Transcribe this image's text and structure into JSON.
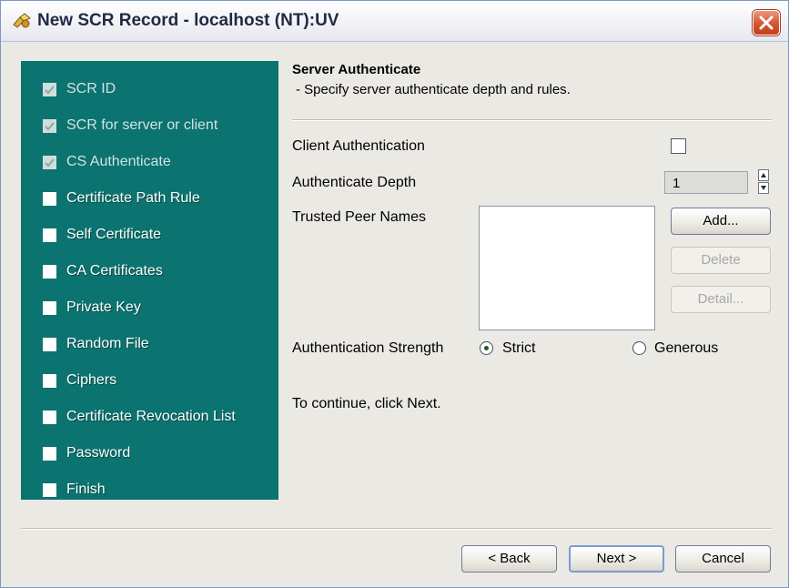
{
  "window": {
    "title": "New SCR Record - localhost (NT):UV"
  },
  "sidebar": {
    "steps": [
      {
        "label": "SCR ID",
        "checked": true
      },
      {
        "label": "SCR for server or client",
        "checked": true
      },
      {
        "label": "CS Authenticate",
        "checked": true
      },
      {
        "label": "Certificate Path Rule",
        "checked": false
      },
      {
        "label": "Self Certificate",
        "checked": false
      },
      {
        "label": "CA Certificates",
        "checked": false
      },
      {
        "label": "Private Key",
        "checked": false
      },
      {
        "label": "Random File",
        "checked": false
      },
      {
        "label": "Ciphers",
        "checked": false
      },
      {
        "label": "Certificate Revocation List",
        "checked": false
      },
      {
        "label": "Password",
        "checked": false
      },
      {
        "label": "Finish",
        "checked": false
      }
    ]
  },
  "header": {
    "title": "Server Authenticate",
    "subtitle": "- Specify server authenticate depth and rules."
  },
  "form": {
    "client_auth_label": "Client Authentication",
    "client_auth_checked": false,
    "depth_label": "Authenticate Depth",
    "depth_value": "1",
    "trusted_label": "Trusted Peer Names",
    "trusted_names": [],
    "add_label": "Add...",
    "delete_label": "Delete",
    "detail_label": "Detail...",
    "strength_label": "Authentication Strength",
    "strict_label": "Strict",
    "generous_label": "Generous",
    "strength_selected": "Strict",
    "continue_text": "To continue, click Next."
  },
  "footer": {
    "back_label": "< Back",
    "next_label": "Next >",
    "cancel_label": "Cancel"
  },
  "colors": {
    "sidebar_bg": "#0b7370",
    "close_button": "#d8532f",
    "dialog_bg": "#ebe9e4"
  },
  "icons": {
    "app": "app-icon",
    "close": "close-icon",
    "checkmark": "checkmark-icon",
    "spinner_up": "spinner-up-icon",
    "spinner_down": "spinner-down-icon"
  }
}
